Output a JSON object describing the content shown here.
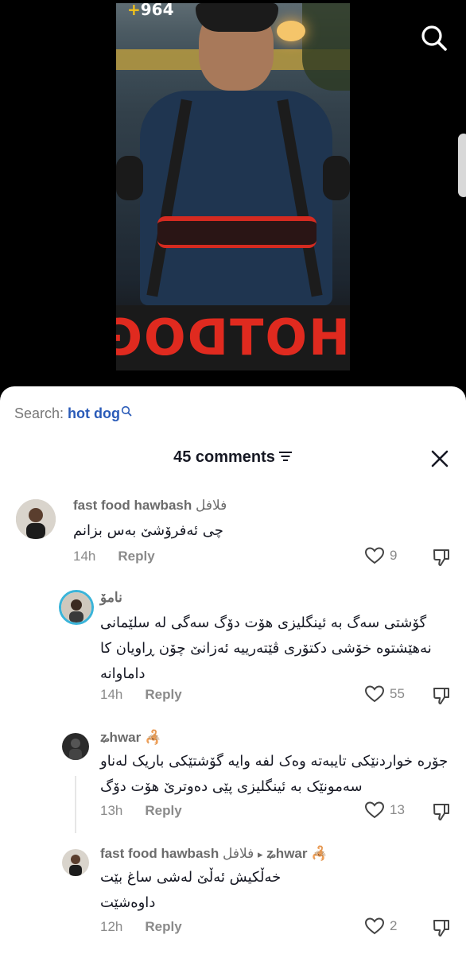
{
  "video": {
    "logo_plus": "+",
    "logo_text": "964",
    "sign_text": "HOTDOG"
  },
  "search": {
    "prefix": "Search: ",
    "query": "hot dog"
  },
  "header": {
    "comments_count": "45 comments"
  },
  "comments": [
    {
      "name": "fast food hawbash",
      "name_suffix": " فلافل",
      "text": "چی ئەفرۆشێ بەس بزانم",
      "time": "14h",
      "reply": "Reply",
      "likes": "9"
    },
    {
      "name": "نامۆ",
      "text": "گۆشتی سەگ بە ئینگلیزی هۆت دۆگ سەگی لە سلێمانی نەهێشتوە خۆشی دکتۆری ڤێتەرییە ئەزانێ چۆن ڕاویان کا داماوانە",
      "time": "14h",
      "reply": "Reply",
      "likes": "55"
    },
    {
      "name": "ʑhwar",
      "name_emoji": "🦂",
      "text": "جۆرە خواردنێکی تایبەتە وەک لفە وایە گۆشتێکی باریک لەناو سەمونێک بە ئینگلیزی پێی دەوترێ هۆت دۆگ",
      "time": "13h",
      "reply": "Reply",
      "likes": "13"
    },
    {
      "name": "fast food hawbash",
      "name_suffix": " فلافل",
      "reply_arrow": "▸",
      "reply_to": "ʑhwar",
      "name_emoji": "🦂",
      "text": "خەڵکیش ئەڵێ لەشی ساغ بێت داوەشێت",
      "time": "12h",
      "reply": "Reply",
      "likes": "2"
    }
  ],
  "colors": {
    "text_primary": "#161823",
    "text_secondary": "#8a8a8a",
    "link_blue": "#2a5bb8",
    "sheet_bg": "#ffffff",
    "story_ring": "#3ab4d9"
  }
}
